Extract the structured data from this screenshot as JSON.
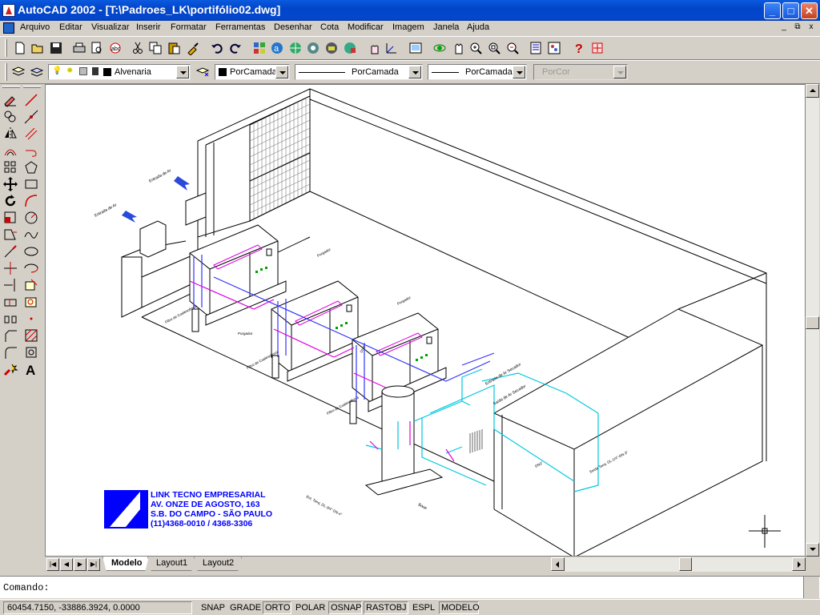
{
  "window": {
    "title": "AutoCAD 2002 - [T:\\Padroes_LK\\portifólio02.dwg]",
    "minimize": "_",
    "maximize": "□",
    "close": "✕"
  },
  "menubar": {
    "items": [
      "Arquivo",
      "Editar",
      "Visualizar",
      "Inserir",
      "Formatar",
      "Ferramentas",
      "Desenhar",
      "Cota",
      "Modificar",
      "Imagem",
      "Janela",
      "Ajuda"
    ],
    "doc_min": "_",
    "doc_restore": "⧉",
    "doc_close": "x"
  },
  "layers_toolbar": {
    "layer_name": "Alvenaria",
    "color": "PorCamada",
    "linetype": "PorCamada",
    "lineweight": "PorCamada",
    "plotstyle": "PorCor"
  },
  "tabs": {
    "items": [
      "Modelo",
      "Layout1",
      "Layout2"
    ],
    "active": "Modelo"
  },
  "command": {
    "prompt": "Comando:"
  },
  "status": {
    "coordinates": "60454.7150, -33886.3924, 0.0000",
    "toggles": [
      {
        "label": "SNAP",
        "on": false
      },
      {
        "label": "GRADE",
        "on": false
      },
      {
        "label": "ORTO",
        "on": true
      },
      {
        "label": "POLAR",
        "on": false
      },
      {
        "label": "OSNAP",
        "on": true
      },
      {
        "label": "RASTOBJ",
        "on": true
      },
      {
        "label": "ESPL",
        "on": false
      },
      {
        "label": "MODELO",
        "on": true
      }
    ]
  },
  "drawing": {
    "logo": {
      "line1": "LINK TECNO EMPRESARIAL",
      "line2": "AV. ONZE DE AGOSTO, 163",
      "line3": "S.B. DO CAMPO - SÃO PAULO",
      "line4": "(11)4368-0010 / 4368-3306"
    },
    "labels": {
      "entrada_ar": "Entrada de Ar",
      "entrada_ar_2": "Entrada de Ar",
      "filtro_1": "Filtro de Coalescência",
      "filtro_2": "Filtro de Coalescência",
      "filtro_3": "Filtro de Coalescência",
      "purgador_1": "Purgador",
      "purgador_2": "Purgador",
      "purgador_3": "Purgador",
      "saida_secador": "Entrada de Ar Secador",
      "saida_linha": "Saída de Ar Secador",
      "base": "Base",
      "dn2": "DN2\"",
      "dn3": "DN3\"",
      "linha_1": "Ent. Tanq. DL-3/4\" DN-4\"",
      "linha_2": "Saída Tanq. DL-1/4\"-DN-3\""
    }
  },
  "colors": {
    "titlebar": "#0347d0",
    "logo_blue": "#0000ff",
    "pipe_cyan": "#00c8e0",
    "pipe_blue": "#3333ff",
    "pipe_magenta": "#e000e0",
    "equipment_green": "#00a000"
  }
}
